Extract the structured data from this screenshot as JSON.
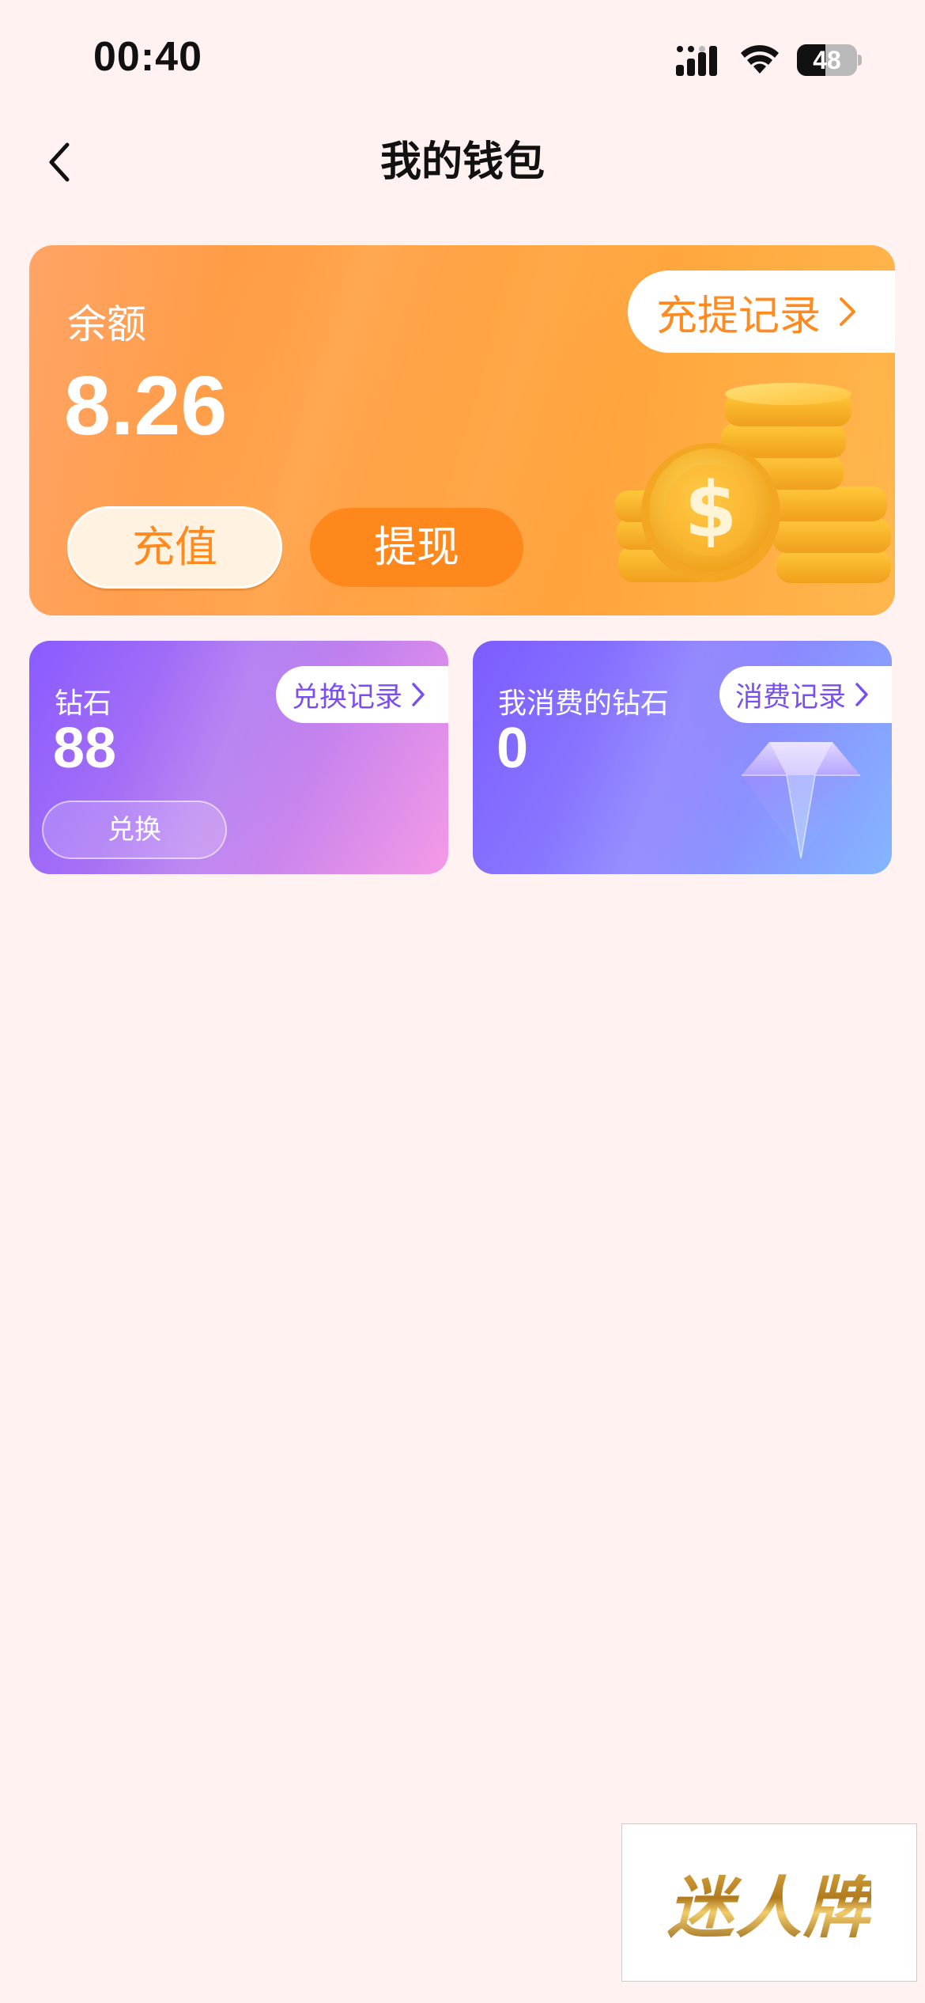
{
  "status_bar": {
    "time": "00:40",
    "battery_level": "48",
    "battery_fraction": 0.48,
    "icons": [
      "signal-icon",
      "wifi-icon",
      "battery-icon"
    ]
  },
  "nav": {
    "title": "我的钱包",
    "back_icon": "chevron-left-icon"
  },
  "balance_card": {
    "label": "余额",
    "amount": "8.26",
    "history_link": "充提记录",
    "recharge_label": "充值",
    "withdraw_label": "提现",
    "illustration": "gold-coins-icon"
  },
  "diamond_card": {
    "label": "钻石",
    "value": "88",
    "history_link": "兑换记录",
    "exchange_label": "兑换"
  },
  "spent_card": {
    "label": "我消费的钻石",
    "value": "0",
    "history_link": "消费记录",
    "illustration": "diamond-icon"
  },
  "watermark": {
    "text": "迷人牌"
  },
  "colors": {
    "background": "#FFF2F1",
    "balance_orange": "#FF9A3A",
    "withdraw_orange": "#FF881C",
    "diamond_purple": "#8A5BFF",
    "diamond_pink": "#F59AE6",
    "spent_blue": "#84B6FF",
    "link_purple": "#7B4EF2"
  }
}
